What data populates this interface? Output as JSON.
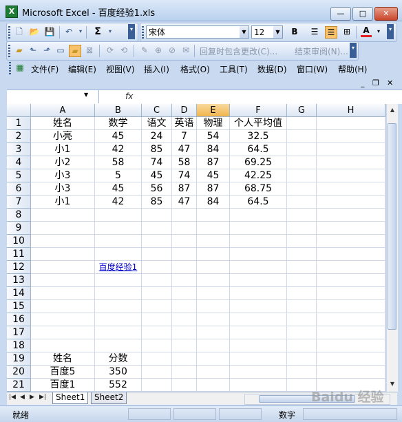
{
  "window": {
    "title": "Microsoft Excel - 百度经验1.xls",
    "app_icon_letter": "X",
    "minimize": "—",
    "maximize": "□",
    "close": "✕"
  },
  "toolbar": {
    "font_name": "宋体",
    "font_size": "12",
    "sum_symbol": "Σ",
    "bold": "B",
    "font_color_letter": "A",
    "reply_changes": "回复时包含更改(C)...",
    "end_review": "结束审阅(N)..."
  },
  "menu": {
    "items": [
      "文件(F)",
      "编辑(E)",
      "视图(V)",
      "插入(I)",
      "格式(O)",
      "工具(T)",
      "数据(D)",
      "窗口(W)",
      "帮助(H)"
    ],
    "minimize": "_",
    "restore": "❐",
    "close": "✕"
  },
  "formula_bar": {
    "name_box": "",
    "fx_label": "fx",
    "content": ""
  },
  "grid": {
    "columns": [
      "A",
      "B",
      "C",
      "D",
      "E",
      "F",
      "G",
      "H"
    ],
    "rows": [
      "1",
      "2",
      "3",
      "4",
      "5",
      "6",
      "7",
      "8",
      "9",
      "10",
      "11",
      "12",
      "13",
      "14",
      "15",
      "16",
      "17",
      "18",
      "19",
      "20",
      "21"
    ],
    "cells": [
      {
        "col": "A",
        "row": 1,
        "text": "姓名"
      },
      {
        "col": "B",
        "row": 1,
        "text": "数学"
      },
      {
        "col": "C",
        "row": 1,
        "text": "语文"
      },
      {
        "col": "D",
        "row": 1,
        "text": "英语"
      },
      {
        "col": "E",
        "row": 1,
        "text": "物理"
      },
      {
        "col": "F",
        "row": 1,
        "text": "个人平均值"
      },
      {
        "col": "A",
        "row": 2,
        "text": "小亮"
      },
      {
        "col": "B",
        "row": 2,
        "text": "45"
      },
      {
        "col": "C",
        "row": 2,
        "text": "24"
      },
      {
        "col": "D",
        "row": 2,
        "text": "7"
      },
      {
        "col": "E",
        "row": 2,
        "text": "54"
      },
      {
        "col": "F",
        "row": 2,
        "text": "32.5"
      },
      {
        "col": "A",
        "row": 3,
        "text": "小1"
      },
      {
        "col": "B",
        "row": 3,
        "text": "42"
      },
      {
        "col": "C",
        "row": 3,
        "text": "85"
      },
      {
        "col": "D",
        "row": 3,
        "text": "47"
      },
      {
        "col": "E",
        "row": 3,
        "text": "84"
      },
      {
        "col": "F",
        "row": 3,
        "text": "64.5"
      },
      {
        "col": "A",
        "row": 4,
        "text": "小2"
      },
      {
        "col": "B",
        "row": 4,
        "text": "58"
      },
      {
        "col": "C",
        "row": 4,
        "text": "74"
      },
      {
        "col": "D",
        "row": 4,
        "text": "58"
      },
      {
        "col": "E",
        "row": 4,
        "text": "87"
      },
      {
        "col": "F",
        "row": 4,
        "text": "69.25"
      },
      {
        "col": "A",
        "row": 5,
        "text": "小3"
      },
      {
        "col": "B",
        "row": 5,
        "text": "5"
      },
      {
        "col": "C",
        "row": 5,
        "text": "45"
      },
      {
        "col": "D",
        "row": 5,
        "text": "74"
      },
      {
        "col": "E",
        "row": 5,
        "text": "45"
      },
      {
        "col": "F",
        "row": 5,
        "text": "42.25"
      },
      {
        "col": "A",
        "row": 6,
        "text": "小3"
      },
      {
        "col": "B",
        "row": 6,
        "text": "45"
      },
      {
        "col": "C",
        "row": 6,
        "text": "56"
      },
      {
        "col": "D",
        "row": 6,
        "text": "87"
      },
      {
        "col": "E",
        "row": 6,
        "text": "87"
      },
      {
        "col": "F",
        "row": 6,
        "text": "68.75"
      },
      {
        "col": "A",
        "row": 7,
        "text": "小1"
      },
      {
        "col": "B",
        "row": 7,
        "text": "42"
      },
      {
        "col": "C",
        "row": 7,
        "text": "85"
      },
      {
        "col": "D",
        "row": 7,
        "text": "47"
      },
      {
        "col": "E",
        "row": 7,
        "text": "84"
      },
      {
        "col": "F",
        "row": 7,
        "text": "64.5"
      },
      {
        "col": "B",
        "row": 12,
        "text": "百度经验1",
        "link": true
      },
      {
        "col": "A",
        "row": 19,
        "text": "姓名"
      },
      {
        "col": "B",
        "row": 19,
        "text": "分数"
      },
      {
        "col": "A",
        "row": 20,
        "text": "百度5"
      },
      {
        "col": "B",
        "row": 20,
        "text": "350"
      },
      {
        "col": "A",
        "row": 21,
        "text": "百度1"
      },
      {
        "col": "B",
        "row": 21,
        "text": "552"
      }
    ],
    "selected_column": "E"
  },
  "sheets": {
    "tabs": [
      "Sheet1",
      "Sheet2"
    ],
    "active": "Sheet1"
  },
  "status": {
    "ready": "就绪",
    "mode": "数字"
  },
  "watermark": "Baidu 经验"
}
